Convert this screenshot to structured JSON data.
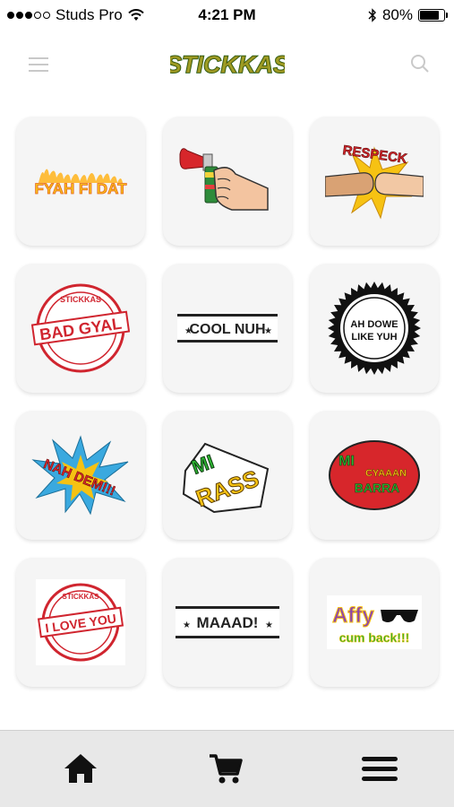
{
  "status_bar": {
    "carrier": "Studs Pro",
    "time": "4:21 PM",
    "battery": "80%",
    "battery_level": 0.8,
    "signal_bars_filled": 3,
    "signal_bars_total": 5
  },
  "header": {
    "logo_text": "STICKKAS",
    "menu_icon": "hamburger-icon",
    "search_icon": "search-icon"
  },
  "stickers": [
    {
      "id": "fyah-fi-dat",
      "text": "FYAH FI DAT"
    },
    {
      "id": "air-horn",
      "text": ""
    },
    {
      "id": "respeck",
      "text": "RESPECK"
    },
    {
      "id": "bad-gyal",
      "text": "BAD GYAL",
      "ring": "STICKKAS"
    },
    {
      "id": "cool-nuh",
      "text": "COOL NUH"
    },
    {
      "id": "ah-dowe-like-yuh",
      "line1": "AH DOWE",
      "line2": "LIKE YUH"
    },
    {
      "id": "nah-dem",
      "text": "NAH DEM!!!"
    },
    {
      "id": "mi-rass",
      "line1": "MI",
      "line2": "RASS"
    },
    {
      "id": "mi-cyaaan-barra",
      "line1": "MI",
      "line2": "CYAAAN",
      "line3": "BARRA"
    },
    {
      "id": "i-love-you",
      "text": "I LOVE YOU",
      "ring": "STICKKAS"
    },
    {
      "id": "maaad",
      "text": "MAAAD!"
    },
    {
      "id": "affy-cum-back",
      "line1": "Affy",
      "line2": "cum back!!!"
    }
  ],
  "tab_bar": {
    "tabs": [
      {
        "name": "home",
        "icon": "home-icon"
      },
      {
        "name": "cart",
        "icon": "cart-icon"
      },
      {
        "name": "menu",
        "icon": "menu-icon"
      }
    ]
  },
  "colors": {
    "tile_bg": "#f5f5f5",
    "tab_bar_bg": "#e8e8e8",
    "logo_green": "#2db432",
    "logo_orange": "#f7941d",
    "stamp_red": "#d0252f"
  }
}
